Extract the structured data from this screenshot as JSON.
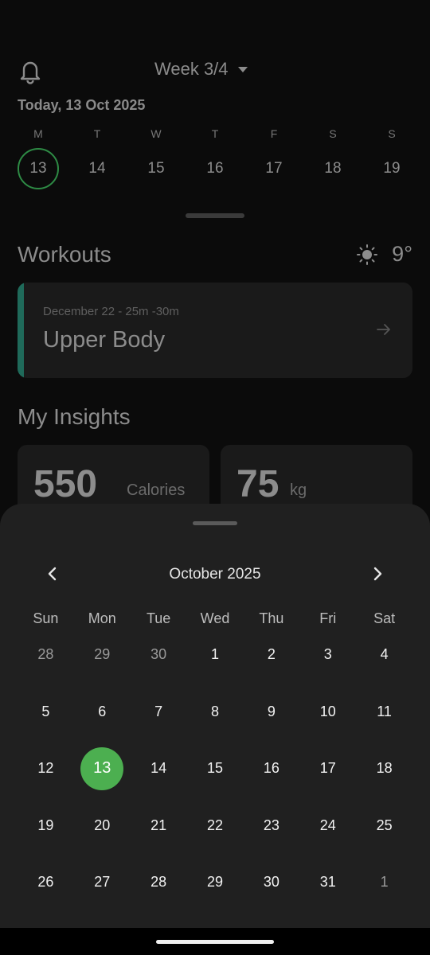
{
  "header": {
    "week_label": "Week 3/4",
    "today_label": "Today, 13 Oct 2025"
  },
  "week": {
    "days": [
      {
        "letter": "M",
        "num": "13",
        "selected": true
      },
      {
        "letter": "T",
        "num": "14"
      },
      {
        "letter": "W",
        "num": "15"
      },
      {
        "letter": "T",
        "num": "16"
      },
      {
        "letter": "F",
        "num": "17"
      },
      {
        "letter": "S",
        "num": "18"
      },
      {
        "letter": "S",
        "num": "19"
      }
    ]
  },
  "workouts": {
    "title": "Workouts",
    "temperature": "9°",
    "card": {
      "meta": "December 22 - 25m -30m",
      "name": "Upper Body"
    }
  },
  "insights": {
    "title": "My Insights",
    "cards": [
      {
        "value": "550",
        "unit": "Calories"
      },
      {
        "value": "75",
        "unit": "kg"
      }
    ]
  },
  "calendar": {
    "month_title": "October 2025",
    "weekday_headers": [
      "Sun",
      "Mon",
      "Tue",
      "Wed",
      "Thu",
      "Fri",
      "Sat"
    ],
    "weeks": [
      [
        {
          "d": "28",
          "m": true
        },
        {
          "d": "29",
          "m": true
        },
        {
          "d": "30",
          "m": true
        },
        {
          "d": "1"
        },
        {
          "d": "2"
        },
        {
          "d": "3"
        },
        {
          "d": "4"
        }
      ],
      [
        {
          "d": "5"
        },
        {
          "d": "6"
        },
        {
          "d": "7"
        },
        {
          "d": "8"
        },
        {
          "d": "9"
        },
        {
          "d": "10"
        },
        {
          "d": "11"
        }
      ],
      [
        {
          "d": "12"
        },
        {
          "d": "13",
          "s": true
        },
        {
          "d": "14"
        },
        {
          "d": "15"
        },
        {
          "d": "16"
        },
        {
          "d": "17"
        },
        {
          "d": "18"
        }
      ],
      [
        {
          "d": "19"
        },
        {
          "d": "20"
        },
        {
          "d": "21"
        },
        {
          "d": "22"
        },
        {
          "d": "23"
        },
        {
          "d": "24"
        },
        {
          "d": "25"
        }
      ],
      [
        {
          "d": "26"
        },
        {
          "d": "27"
        },
        {
          "d": "28"
        },
        {
          "d": "29"
        },
        {
          "d": "30"
        },
        {
          "d": "31"
        },
        {
          "d": "1",
          "m": true
        }
      ]
    ],
    "selected_color": "#4caf50"
  },
  "icons": {
    "bell": "bell-icon",
    "sun": "sun-icon",
    "arrow": "arrow-right-icon",
    "prev": "chevron-left-icon",
    "next": "chevron-right-icon"
  }
}
